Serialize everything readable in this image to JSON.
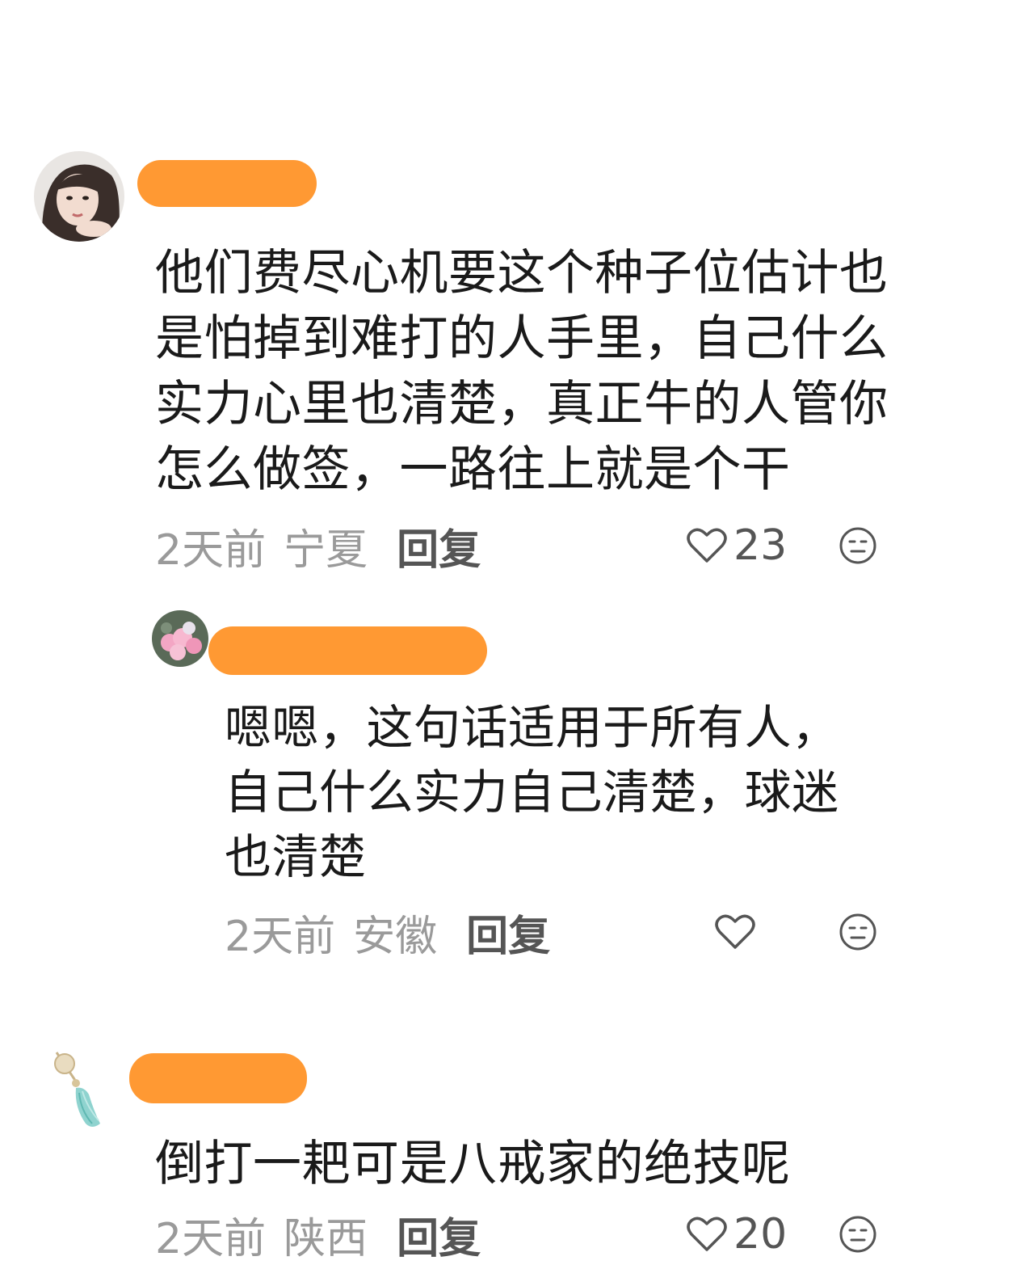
{
  "comments": [
    {
      "text": "他们费尽心机要这个种子位估计也是怕掉到难打的人手里，自己什么实力心里也清楚，真正牛的人管你怎么做签，一路往上就是个干",
      "time": "2天前",
      "location": "宁夏",
      "reply_label": "回复",
      "likes": "23",
      "icons": {
        "like": "heart-outline-icon",
        "emoji": "neutral-face-icon"
      }
    },
    {
      "text": "嗯嗯，这句话适用于所有人，自己什么实力自己清楚，球迷也清楚",
      "time": "2天前",
      "location": "安徽",
      "reply_label": "回复",
      "likes": "",
      "icons": {
        "like": "heart-outline-icon",
        "emoji": "neutral-face-icon"
      }
    },
    {
      "text": "倒打一耙可是八戒家的绝技呢",
      "time": "2天前",
      "location": "陕西",
      "reply_label": "回复",
      "likes": "20",
      "icons": {
        "like": "heart-outline-icon",
        "emoji": "neutral-face-icon"
      }
    }
  ],
  "colors": {
    "redaction": "#ff9933",
    "meta_gray": "#9a9a9a",
    "text": "#1a1a1a"
  }
}
